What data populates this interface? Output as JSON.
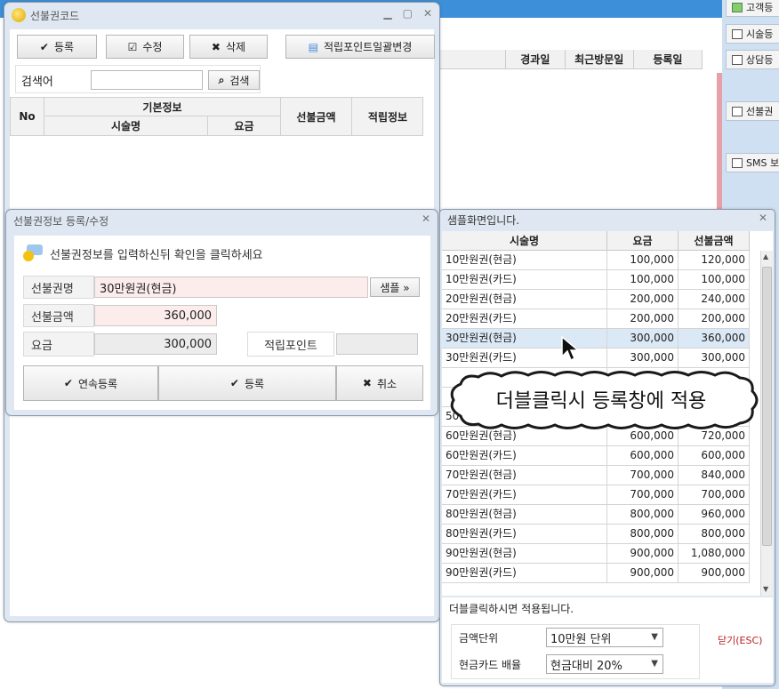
{
  "background": {
    "columns": [
      "경과일",
      "최근방문일",
      "등록일"
    ],
    "side_buttons": [
      "고객등",
      "시술등",
      "상담등",
      "선불권",
      "SMS 보"
    ]
  },
  "prepaid_window": {
    "title": "선불권코드",
    "toolbar": {
      "register": "등록",
      "edit": "수정",
      "delete": "삭제",
      "points_bulk": "적립포인트일괄변경"
    },
    "search": {
      "label": "검색어",
      "value": "",
      "button": "검색"
    },
    "table": {
      "no": "No",
      "basic_info": "기본정보",
      "treatment_name": "시술명",
      "fee": "요금",
      "prepaid_amount": "선불금액",
      "points_info": "적립정보"
    }
  },
  "form_window": {
    "title": "선불권정보 등록/수정",
    "instruction": "선불권정보를 입력하신뒤 확인을 클릭하세요",
    "labels": {
      "name": "선불권명",
      "amount": "선불금액",
      "fee": "요금",
      "points": "적립포인트"
    },
    "values": {
      "name": "30만원권(현금)",
      "amount": "360,000",
      "fee": "300,000",
      "points": ""
    },
    "sample_button": "샘플 »",
    "buttons": {
      "continuous": "연속등록",
      "register": "등록",
      "cancel": "취소"
    }
  },
  "sample_window": {
    "title": "샘플화면입니다.",
    "headers": [
      "시술명",
      "요금",
      "선불금액"
    ],
    "rows": [
      [
        "10만원권(현금)",
        "100,000",
        "120,000"
      ],
      [
        "10만원권(카드)",
        "100,000",
        "100,000"
      ],
      [
        "20만원권(현금)",
        "200,000",
        "240,000"
      ],
      [
        "20만원권(카드)",
        "200,000",
        "200,000"
      ],
      [
        "30만원권(현금)",
        "300,000",
        "360,000"
      ],
      [
        "30만원권(카드)",
        "300,000",
        "300,000"
      ],
      [
        "",
        "",
        ""
      ],
      [
        "",
        "",
        ""
      ],
      [
        "50만원권(카드)",
        "500,000",
        "500,000"
      ],
      [
        "60만원권(현금)",
        "600,000",
        "720,000"
      ],
      [
        "60만원권(카드)",
        "600,000",
        "600,000"
      ],
      [
        "70만원권(현금)",
        "700,000",
        "840,000"
      ],
      [
        "70만원권(카드)",
        "700,000",
        "700,000"
      ],
      [
        "80만원권(현금)",
        "800,000",
        "960,000"
      ],
      [
        "80만원권(카드)",
        "800,000",
        "800,000"
      ],
      [
        "90만원권(현금)",
        "900,000",
        "1,080,000"
      ],
      [
        "90만원권(카드)",
        "900,000",
        "900,000"
      ]
    ],
    "hint": "더블클릭하시면 적용됩니다.",
    "amount_unit_label": "금액단위",
    "amount_unit_value": "10만원 단위",
    "cash_card_label": "현금카드 배율",
    "cash_card_value": "현금대비 20%",
    "close": "닫기(ESC)"
  },
  "callout": "더블클릭시 등록창에 적용"
}
